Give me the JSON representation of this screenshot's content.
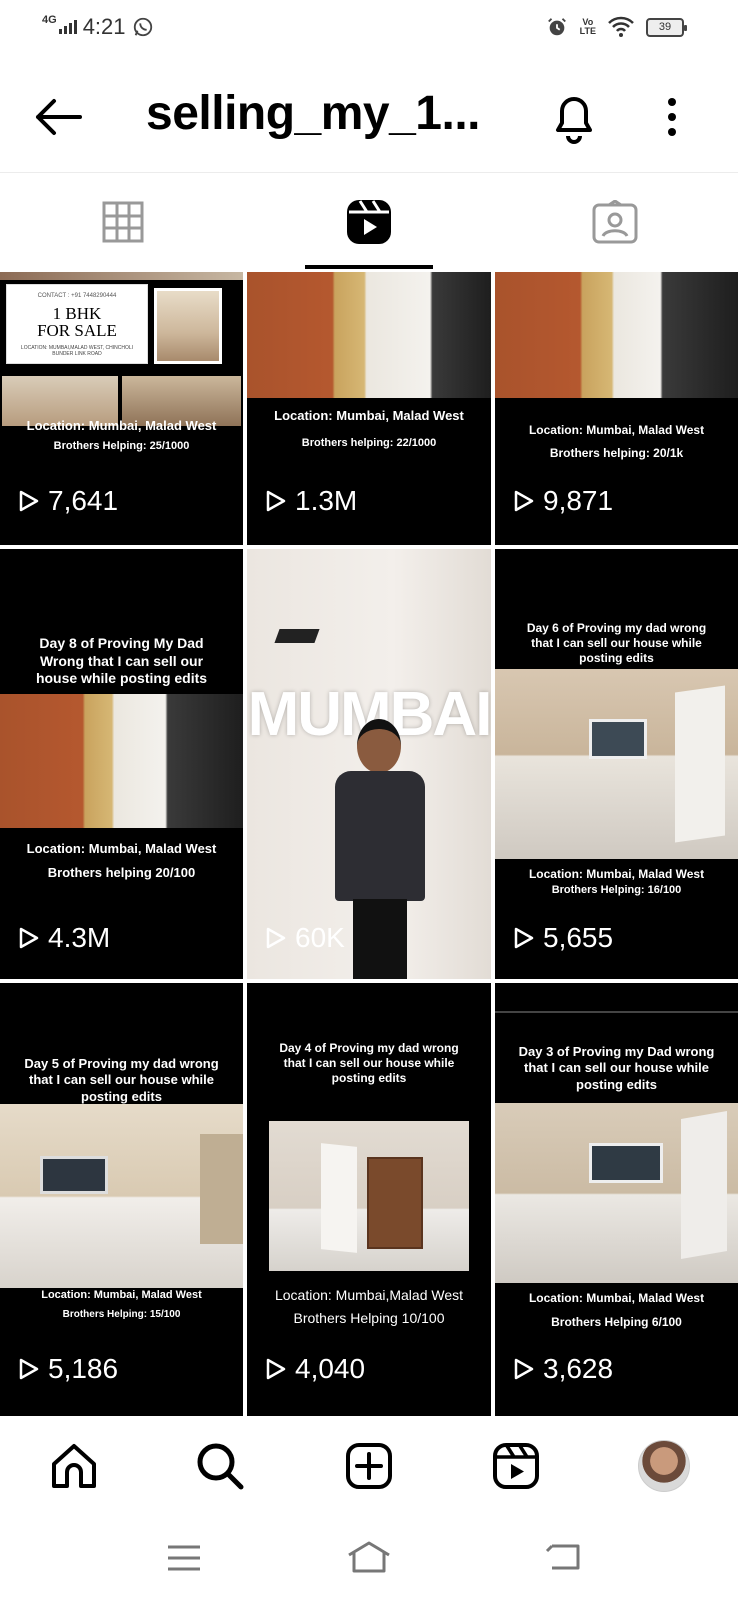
{
  "status_bar": {
    "network": "4G",
    "time": "4:21",
    "volte": "Vo\nLTE",
    "battery": "39"
  },
  "header": {
    "title": "selling_my_1..."
  },
  "tabs": [
    {
      "name": "grid-tab"
    },
    {
      "name": "reels-tab",
      "active": true
    },
    {
      "name": "tagged-tab"
    }
  ],
  "reels": [
    {
      "lines": [
        "Location: Mumbai, Malad West",
        "Brothers Helping: 25/1000"
      ],
      "views": "7,641",
      "flyer": {
        "contact": "CONTACT : +91 7448290444",
        "title": "1 BHK\nFOR SALE",
        "location": "LOCATION: MUMBAI,MALAD WEST, CHINCHOLI BUNDER LINK ROAD"
      }
    },
    {
      "lines": [
        "Location: Mumbai,  Malad West",
        "Brothers helping: 22/1000"
      ],
      "views": "1.3M"
    },
    {
      "lines": [
        "Location: Mumbai, Malad West",
        "Brothers helping: 20/1k"
      ],
      "views": "9,871"
    },
    {
      "top_text": "Day 8 of Proving My Dad Wrong that I can sell our house while posting edits",
      "lines": [
        "Location: Mumbai, Malad West",
        "Brothers helping 20/100"
      ],
      "views": "4.3M"
    },
    {
      "overlay": "MUMBAI",
      "views": "60K"
    },
    {
      "top_text": "Day 6 of Proving my dad wrong that I can sell our house while posting edits",
      "lines": [
        "Location: Mumbai, Malad West",
        "Brothers Helping: 16/100"
      ],
      "views": "5,655"
    },
    {
      "top_text": "Day 5 of Proving my dad wrong that I can sell our house while posting edits",
      "lines": [
        "Location: Mumbai, Malad West",
        "Brothers Helping: 15/100"
      ],
      "views": "5,186"
    },
    {
      "top_text": "Day 4 of Proving my dad wrong that I can sell our house while posting edits",
      "lines": [
        "Location: Mumbai,Malad West",
        "Brothers Helping 10/100"
      ],
      "views": "4,040"
    },
    {
      "top_text": "Day 3 of Proving my Dad wrong that I can sell our house while posting edits",
      "lines": [
        "Location: Mumbai, Malad West",
        "Brothers Helping 6/100"
      ],
      "views": "3,628"
    }
  ],
  "bottom_nav": [
    {
      "name": "home-icon"
    },
    {
      "name": "search-icon"
    },
    {
      "name": "create-icon"
    },
    {
      "name": "reels-icon"
    },
    {
      "name": "profile-avatar"
    }
  ],
  "system_nav": [
    {
      "name": "menu-icon"
    },
    {
      "name": "home-key-icon"
    },
    {
      "name": "back-key-icon"
    }
  ]
}
